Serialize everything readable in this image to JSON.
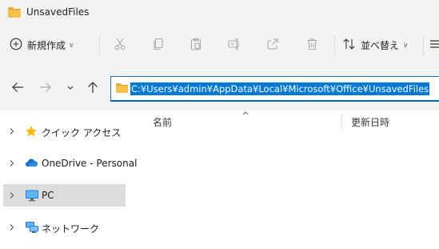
{
  "window": {
    "title": "UnsavedFiles"
  },
  "toolbar": {
    "new_label": "新規作成",
    "sort_label": "並べ替え",
    "icons": [
      "plus-circle-icon",
      "cut-icon",
      "copy-icon",
      "paste-icon",
      "rename-icon",
      "share-icon",
      "delete-icon",
      "sort-icon",
      "view-icon"
    ]
  },
  "address": {
    "path": "C:¥Users¥admin¥AppData¥Local¥Microsoft¥Office¥UnsavedFiles"
  },
  "sidebar": {
    "items": [
      {
        "label": "クイック アクセス",
        "icon": "star-icon",
        "selected": false
      },
      {
        "label": "OneDrive - Personal",
        "icon": "cloud-icon",
        "selected": false
      },
      {
        "label": "PC",
        "icon": "monitor-icon",
        "selected": true
      },
      {
        "label": "ネットワーク",
        "icon": "network-icon",
        "selected": false
      }
    ]
  },
  "columns": {
    "name": "名前",
    "date": "更新日時"
  },
  "colors": {
    "accent": "#0078d4",
    "folder": "#f4c14f",
    "selected_bg": "#dcdcdc"
  }
}
